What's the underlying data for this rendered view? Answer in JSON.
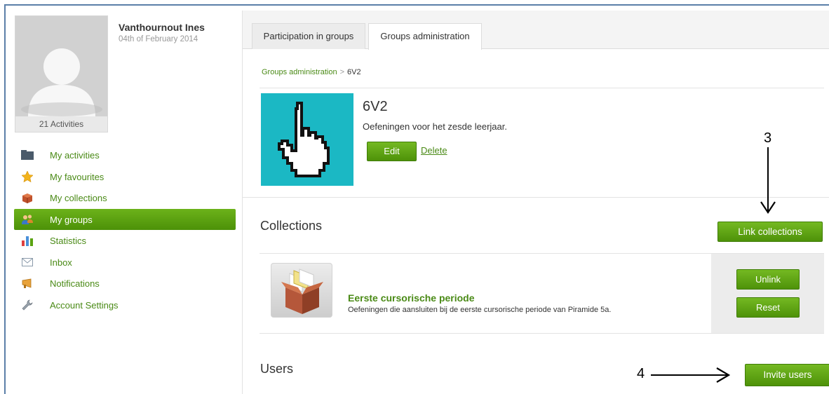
{
  "profile": {
    "name": "Vanthournout Ines",
    "date": "04th of February 2014",
    "activities_count": "21 Activities"
  },
  "nav": {
    "items": [
      {
        "label": "My activities",
        "icon": "folder-icon"
      },
      {
        "label": "My favourites",
        "icon": "star-icon"
      },
      {
        "label": "My collections",
        "icon": "box-icon"
      },
      {
        "label": "My groups",
        "icon": "users-icon",
        "active": true
      },
      {
        "label": "Statistics",
        "icon": "bar-chart-icon"
      },
      {
        "label": "Inbox",
        "icon": "envelope-icon"
      },
      {
        "label": "Notifications",
        "icon": "megaphone-icon"
      },
      {
        "label": "Account Settings",
        "icon": "wrench-icon"
      }
    ]
  },
  "tabs": [
    {
      "label": "Participation in groups"
    },
    {
      "label": "Groups administration",
      "active": true
    }
  ],
  "breadcrumb": {
    "root": "Groups administration",
    "separator": ">",
    "current": "6V2"
  },
  "group": {
    "title": "6V2",
    "description": "Oefeningen voor het zesde leerjaar.",
    "edit_label": "Edit",
    "delete_label": "Delete",
    "image_icon": "hand-pointer-icon"
  },
  "collections": {
    "heading": "Collections",
    "link_button": "Link collections",
    "items": [
      {
        "title": "Eerste cursorische periode",
        "description": "Oefeningen die aansluiten bij de eerste cursorische periode van Piramide 5a.",
        "unlink_label": "Unlink",
        "reset_label": "Reset",
        "icon": "open-box-icon"
      }
    ]
  },
  "users": {
    "heading": "Users",
    "invite_button": "Invite users"
  },
  "annotations": {
    "a3": "3",
    "a4": "4"
  },
  "colors": {
    "accent_green": "#5aa312",
    "link_green": "#4a8a16",
    "group_image_bg": "#1bb8c4"
  }
}
